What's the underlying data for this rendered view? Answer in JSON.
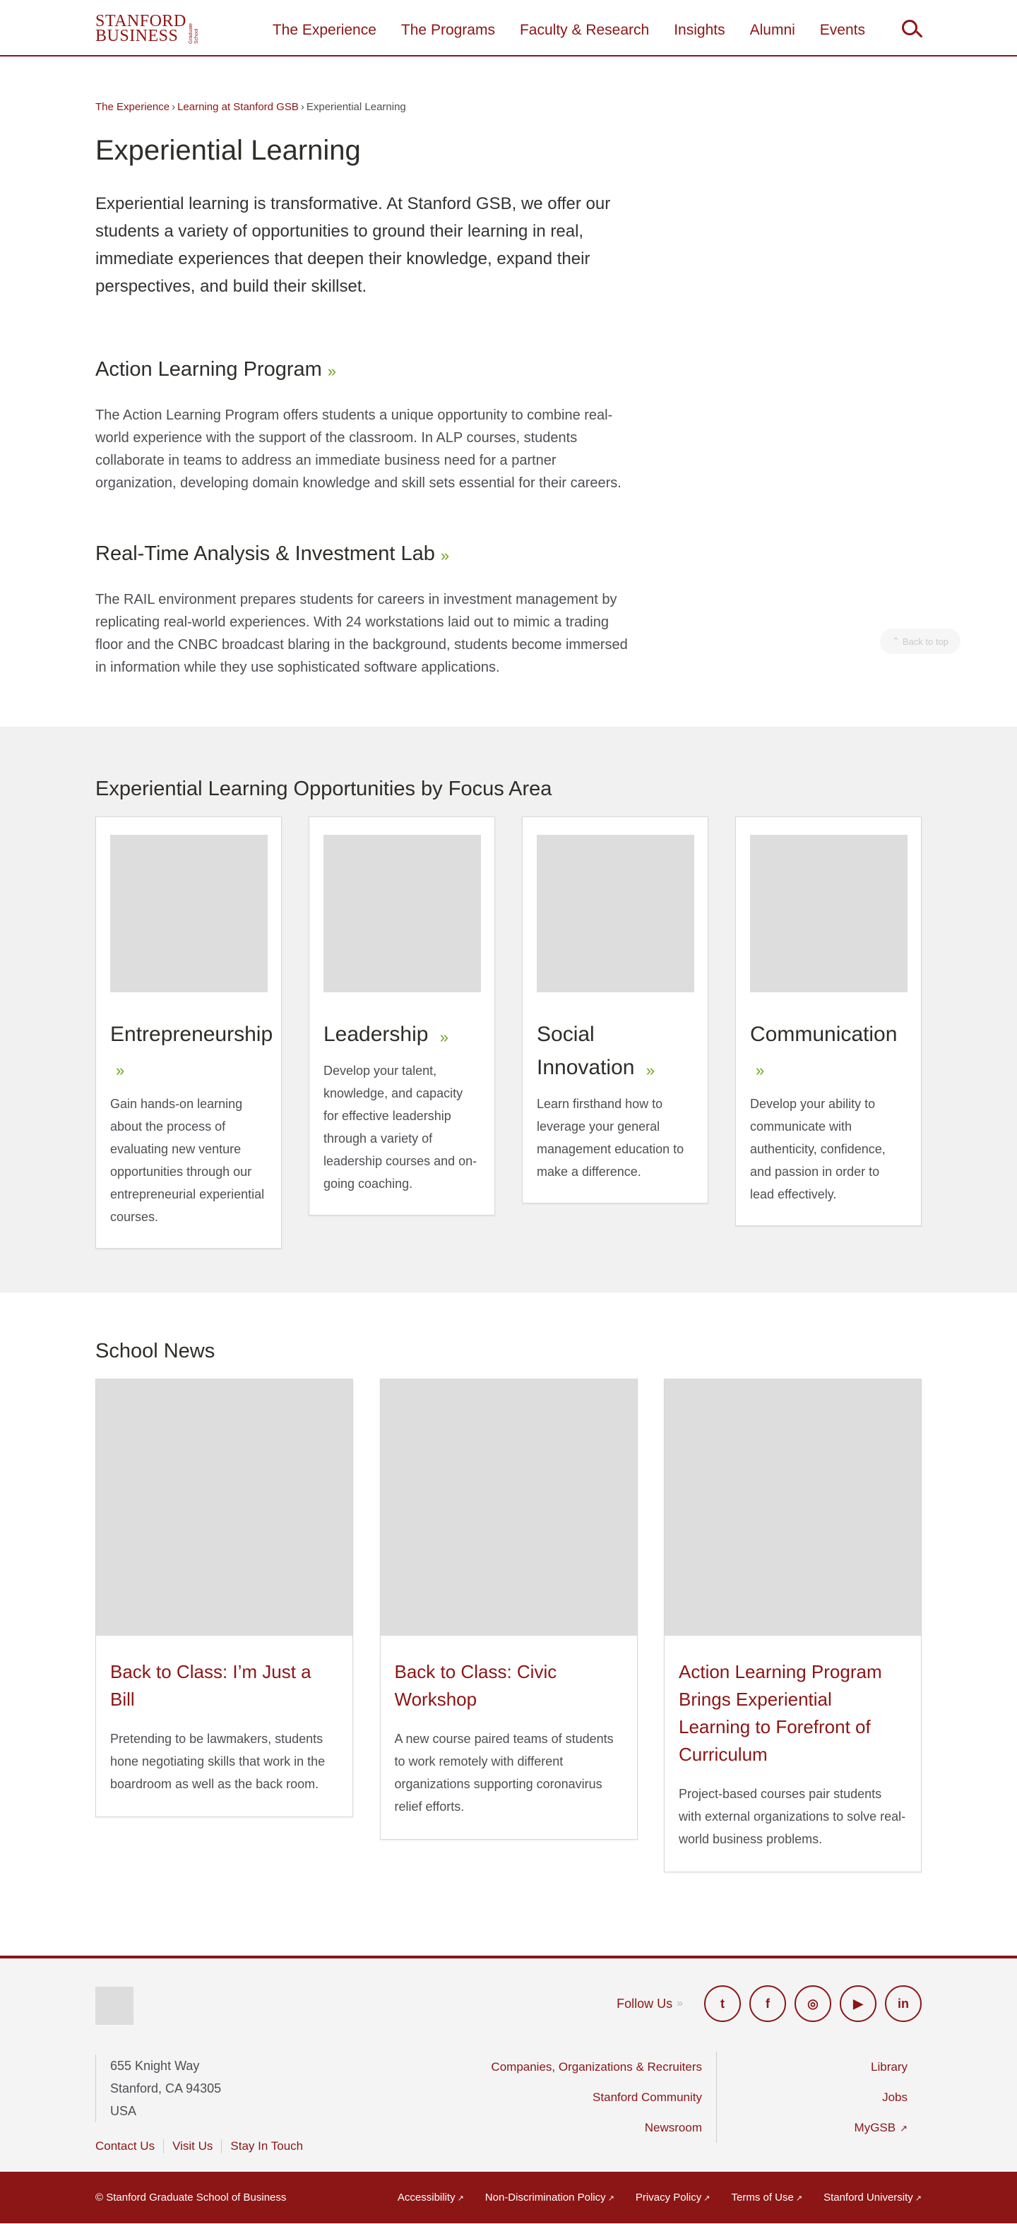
{
  "header": {
    "logo": {
      "line1": "STANFORD",
      "line2": "BUSINESS",
      "side": "Graduate School"
    },
    "nav": [
      "The Experience",
      "The Programs",
      "Faculty & Research",
      "Insights",
      "Alumni",
      "Events"
    ]
  },
  "breadcrumb": {
    "items": [
      "The Experience",
      "Learning at Stanford GSB"
    ],
    "current": "Experiential Learning",
    "separator": "›"
  },
  "page": {
    "title": "Experiential Learning",
    "lead": "Experiential learning is transformative. At Stanford GSB, we offer our students a variety of opportunities to ground their learning in real, immediate experiences that deepen their knowledge, expand their perspectives, and build their skillset."
  },
  "sections": [
    {
      "title": "Action Learning Program",
      "text": "The Action Learning Program offers students a unique opportunity to combine real-world experience with the support of the classroom. In ALP courses, students collaborate in teams to address an immediate business need for a partner organization, developing domain knowledge and skill sets essential for their careers."
    },
    {
      "title": "Real-Time Analysis & Investment Lab",
      "text": "The RAIL environment prepares students for careers in investment management by replicating real-world experiences. With 24 workstations laid out to mimic a trading floor and the CNBC broadcast blaring in the background, students become immersed in information while they use sophisticated software applications."
    }
  ],
  "back_to_top": "Back to top",
  "chevron": "»",
  "focus": {
    "title": "Experiential Learning Opportunities by Focus Area",
    "cards": [
      {
        "title": "Entrepreneurship",
        "text": "Gain hands-on learning about the process of evaluating new venture opportunities through our entrepreneurial experiential courses."
      },
      {
        "title": "Leadership",
        "text": "Develop your talent, knowledge, and capacity for effective leadership through a variety of leadership courses and on-going coaching."
      },
      {
        "title": "Social Innovation",
        "text": "Learn firsthand how to leverage your general management education to make a difference."
      },
      {
        "title": "Communication",
        "text": "Develop your ability to communicate with authenticity, confidence, and passion in order to lead effectively."
      }
    ]
  },
  "news": {
    "title": "School News",
    "items": [
      {
        "title": "Back to Class: I’m Just a Bill",
        "text": "Pretending to be lawmakers, students hone negotiating skills that work in the boardroom as well as the back room."
      },
      {
        "title": "Back to Class: Civic Workshop",
        "text": "A new course paired teams of students to work remotely with different organizations supporting coronavirus relief efforts."
      },
      {
        "title": "Action Learning Program Brings Experiential Learning to Forefront of Curriculum",
        "text": "Project-based courses pair students with external organizations to solve real-world business problems."
      }
    ]
  },
  "footer": {
    "follow_label": "Follow Us",
    "social": [
      {
        "name": "twitter",
        "glyph": "t"
      },
      {
        "name": "facebook",
        "glyph": "f"
      },
      {
        "name": "instagram",
        "glyph": "◎"
      },
      {
        "name": "youtube",
        "glyph": "▶"
      },
      {
        "name": "linkedin",
        "glyph": "in"
      }
    ],
    "address": [
      "655 Knight Way",
      "Stanford, CA 94305",
      "USA"
    ],
    "links_left": [
      "Contact Us",
      "Visit Us",
      "Stay In Touch"
    ],
    "col1": [
      "Companies, Organizations & Recruiters",
      "Stanford Community",
      "Newsroom"
    ],
    "col2": [
      "Library",
      "Jobs",
      "MyGSB"
    ]
  },
  "bottom": {
    "copyright": "© Stanford Graduate School of Business",
    "links": [
      "Accessibility",
      "Non-Discrimination Policy",
      "Privacy Policy",
      "Terms of Use",
      "Stanford University"
    ]
  },
  "colors": {
    "brand": "#8c1515",
    "accent": "#6fa51b",
    "panel": "#f2f1f1"
  }
}
